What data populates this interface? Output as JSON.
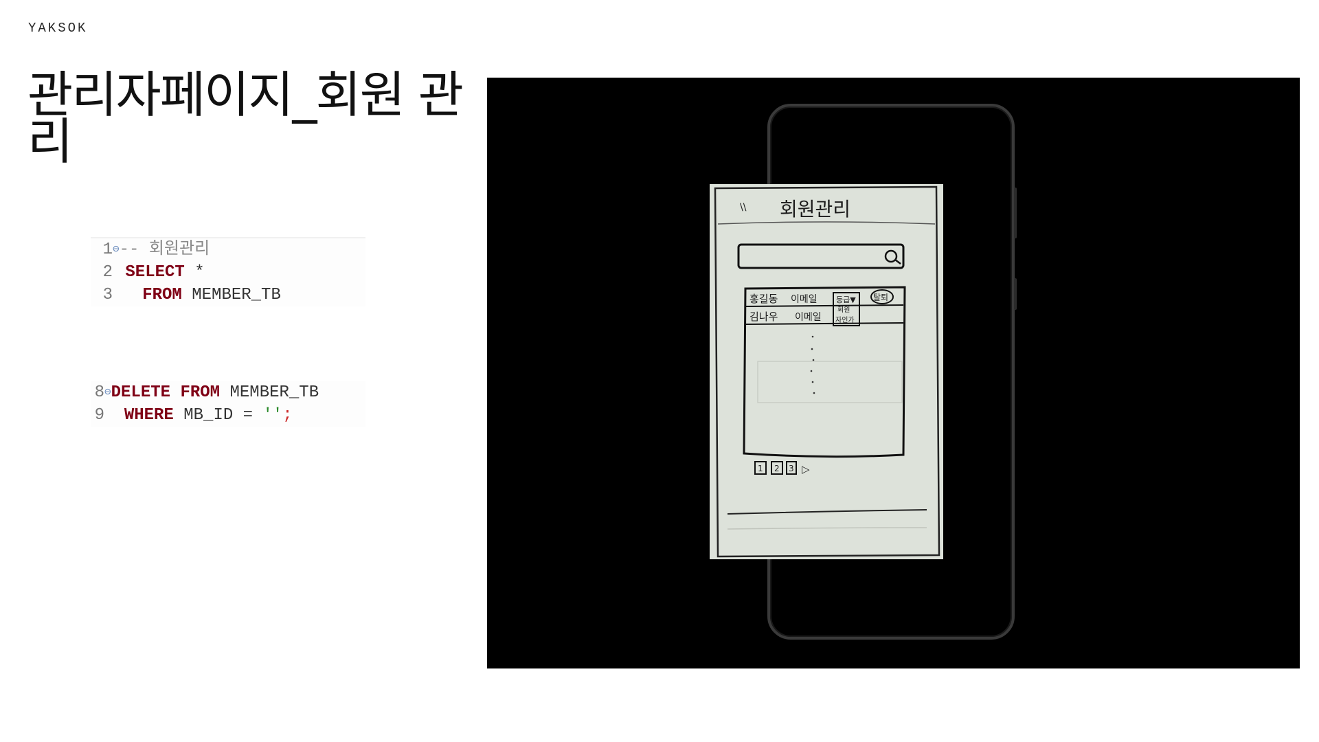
{
  "brand": "YAKSOK",
  "title": "관리자페이지_회원 관리",
  "code_block_1": {
    "lines": [
      {
        "num": "1",
        "comment": "-- 회원관리"
      },
      {
        "num": "2",
        "kw1": "SELECT",
        "rest": " *"
      },
      {
        "num": "3",
        "kw1": "FROM",
        "rest": " MEMBER_TB"
      }
    ]
  },
  "code_block_2": {
    "lines": [
      {
        "num": "8",
        "kw1": "DELETE",
        "kw2": "FROM",
        "rest": " MEMBER_TB"
      },
      {
        "num": "9",
        "kw1": "WHERE",
        "rest": " MB_ID = ",
        "str": "''",
        "semi": ";"
      }
    ]
  },
  "sketch": {
    "back_mark": "\\\\",
    "header": "회원관리",
    "rows": [
      {
        "name": "홍길동",
        "email": "이메일",
        "grade": "등급▼",
        "action": "탈퇴"
      },
      {
        "name": "김나우",
        "email": "이메일",
        "grade_option_1": "회원",
        "grade_option_2": "자인가"
      }
    ],
    "pages": [
      "1",
      "2",
      "3"
    ],
    "next": "▷"
  }
}
